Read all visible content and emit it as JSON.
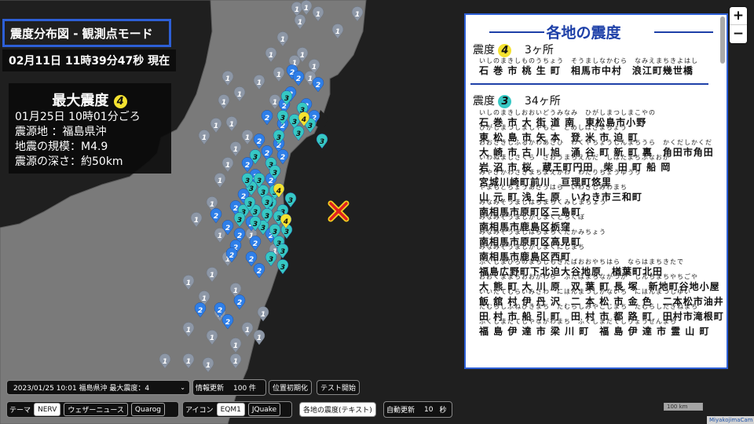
{
  "header": {
    "title": "震度分布図 - 観測点モード",
    "datetime": "02月11日 11時39分47秒 現在"
  },
  "max_intensity": {
    "title": "最大震度",
    "value": "4",
    "lines": [
      "01月25日 10時01分ごろ",
      "震源地 ：福島県沖",
      "地震の規模：M4.9",
      "震源の深さ：約50km"
    ]
  },
  "panel": {
    "title": "各地の震度",
    "sections": [
      {
        "label": "震度",
        "intensity": "4",
        "count": "3ヶ所",
        "rows": [
          {
            "ruby": "いしのまきしものうちょう　そうましなかむら　なみえまちきよはし",
            "kanji": "石 巻 市 桃 生 町　相馬市中村　浪江町幾世橋"
          }
        ]
      },
      {
        "label": "震度",
        "intensity": "3",
        "count": "34ヶ所",
        "rows": [
          {
            "ruby": "いしのまきしおおいどうみなみ　ひがしまつしまこやの",
            "kanji": "石 巻 市 大 街 道 南　東松島市小野"
          },
          {
            "ruby": "ひがしまつしましやもと　とめしはさまちょう",
            "kanji": "東 松 島 市 矢 本　登 米 市 迫 町"
          },
          {
            "ruby": "おおさきしふるかわあさひ　わくやちょうしんまちうら　かくだしかくだ",
            "kanji": "大 崎 市 古 川 旭　涌 谷 町 新 町 裏　角田市角田"
          },
          {
            "ruby": "いわぬましさくら　ざおうまちえんだ　しばたまちふなおか",
            "kanji": "岩 沼 市 桜　蔵王町円田　柴 田 町 船 岡"
          },
          {
            "ruby": "みやぎかわさきまちまえかわ　わたりちょうゆうり",
            "kanji": "宮城川崎町前川　亘理町悠里"
          },
          {
            "ruby": "やまもとちょうあさうはら　いわきしみわまち",
            "kanji": "山 元 町 浅 生 原　いわき市三和町"
          },
          {
            "ruby": "みなみそうましはらまちくみしまちょう",
            "kanji": "南相馬市原町区三島町"
          },
          {
            "ruby": "みなみそうましかしまくとちくぼ",
            "kanji": "南相馬市鹿島区栃窪"
          },
          {
            "ruby": "みなみそうましはらまちくたかみちょう",
            "kanji": "南相馬市原町区高見町"
          },
          {
            "ruby": "みなみそうましかしまくにしまち",
            "kanji": "南相馬市鹿島区西町"
          },
          {
            "ruby": "ふくしまひろのまちしもきたばおおやちはら　ならはまちきたで",
            "kanji": "福島広野町下北迫大谷地原　楢葉町北田"
          },
          {
            "ruby": "おおくままちおおがわら　ふたばまちながつか　しんちまちやちごや",
            "kanji": "大 熊 町 大 川 原　双 葉 町 長 塚　新地町谷地小屋"
          },
          {
            "ruby": "いいたてむらいみざわ　にほんまつしかないろ　にほんまつしゆい",
            "kanji": "飯 舘 村 伊 丹 沢　二 本 松 市 金 色　二本松市油井"
          },
          {
            "ruby": "たむらしふねひきまち　たむらしみやこじまち　たむらしたきねまち",
            "kanji": "田 村 市 船 引 町　田 村 市 都 路 町　田村市滝根町"
          },
          {
            "ruby": "ふくしまだてしやながわまち　ふくしまだてしりょうぜんまち",
            "kanji": "福 島 伊 達 市 梁 川 町　福 島 伊 達 市 霊 山 町"
          }
        ]
      }
    ]
  },
  "controls": {
    "event_select": "2023/01/25 10:01 福島県沖 最大震度：4",
    "info_update_label": "情報更新",
    "info_update_count": "100 件",
    "reset_position": "位置初期化",
    "test_start": "テスト開始",
    "theme_label": "テーマ",
    "themes": [
      "NERV",
      "ウェザーニュース",
      "Quarog"
    ],
    "icon_label": "アイコン",
    "icons": [
      "EQM1",
      "JQuake"
    ],
    "text_view": "各地の震度(テキスト)",
    "auto_update_label": "自動更新",
    "auto_update_value": "10",
    "auto_update_unit": "秒"
  },
  "map": {
    "zoom_in": "+",
    "zoom_out": "−",
    "scale": "100 km",
    "credit": "MiyakojimaCam",
    "epicenter_icon": "epicenter-x-icon",
    "colors": {
      "i1": "#8d97a6",
      "i2": "#2f7fe8",
      "i3": "#36c8c4",
      "i4": "#f5e230",
      "land": "#7a7a7a",
      "sea": "#1f1f1f",
      "accent": "#2d5fd6"
    },
    "stations": {
      "i1": "1",
      "i2": "2",
      "i3": "3",
      "i4": "4"
    }
  }
}
